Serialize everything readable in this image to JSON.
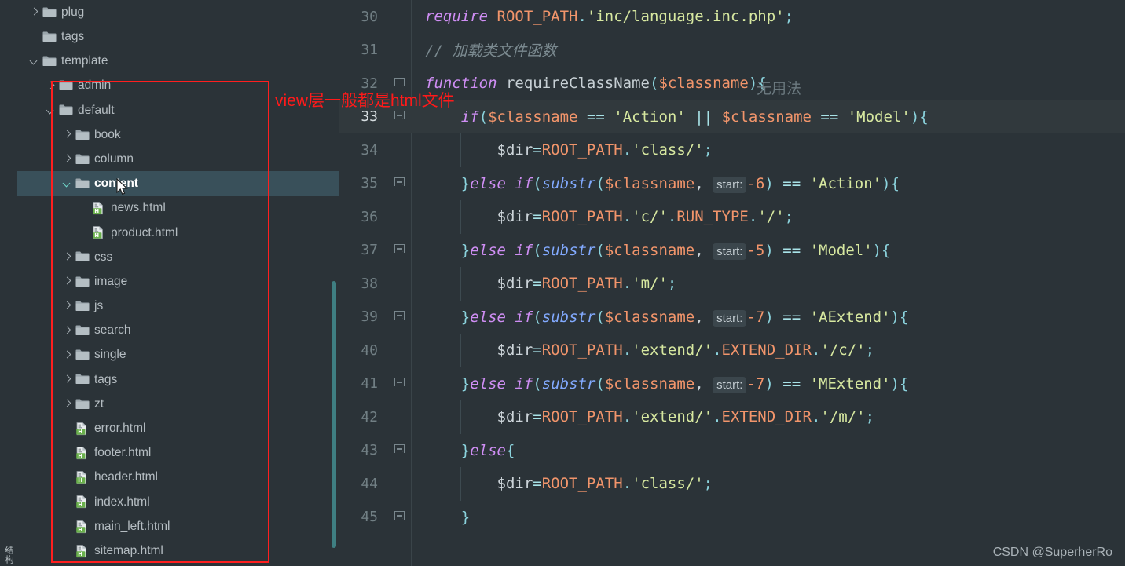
{
  "toolwindow": {
    "label": "结构"
  },
  "tree": {
    "scrollbar_color": "#3f7f82",
    "selected_color": "#39505a",
    "items": [
      {
        "label": "plug",
        "type": "folder",
        "indent": 1,
        "arrow": "right",
        "selected": false
      },
      {
        "label": "tags",
        "type": "folder",
        "indent": 1,
        "arrow": "none",
        "selected": false
      },
      {
        "label": "template",
        "type": "folder",
        "indent": 1,
        "arrow": "down",
        "selected": false
      },
      {
        "label": "admin",
        "type": "folder",
        "indent": 2,
        "arrow": "right",
        "selected": false
      },
      {
        "label": "default",
        "type": "folder",
        "indent": 2,
        "arrow": "down",
        "selected": false
      },
      {
        "label": "book",
        "type": "folder",
        "indent": 3,
        "arrow": "right",
        "selected": false
      },
      {
        "label": "column",
        "type": "folder",
        "indent": 3,
        "arrow": "right",
        "selected": false
      },
      {
        "label": "content",
        "type": "folder",
        "indent": 3,
        "arrow": "down",
        "selected": true
      },
      {
        "label": "news.html",
        "type": "html",
        "indent": 4,
        "arrow": "none",
        "selected": false
      },
      {
        "label": "product.html",
        "type": "html",
        "indent": 4,
        "arrow": "none",
        "selected": false
      },
      {
        "label": "css",
        "type": "folder",
        "indent": 3,
        "arrow": "right",
        "selected": false
      },
      {
        "label": "image",
        "type": "folder",
        "indent": 3,
        "arrow": "right",
        "selected": false
      },
      {
        "label": "js",
        "type": "folder",
        "indent": 3,
        "arrow": "right",
        "selected": false
      },
      {
        "label": "search",
        "type": "folder",
        "indent": 3,
        "arrow": "right",
        "selected": false
      },
      {
        "label": "single",
        "type": "folder",
        "indent": 3,
        "arrow": "right",
        "selected": false
      },
      {
        "label": "tags",
        "type": "folder",
        "indent": 3,
        "arrow": "right",
        "selected": false
      },
      {
        "label": "zt",
        "type": "folder",
        "indent": 3,
        "arrow": "right",
        "selected": false
      },
      {
        "label": "error.html",
        "type": "html",
        "indent": 3,
        "arrow": "none",
        "selected": false
      },
      {
        "label": "footer.html",
        "type": "html",
        "indent": 3,
        "arrow": "none",
        "selected": false
      },
      {
        "label": "header.html",
        "type": "html",
        "indent": 3,
        "arrow": "none",
        "selected": false
      },
      {
        "label": "index.html",
        "type": "html",
        "indent": 3,
        "arrow": "none",
        "selected": false
      },
      {
        "label": "main_left.html",
        "type": "html",
        "indent": 3,
        "arrow": "none",
        "selected": false
      },
      {
        "label": "sitemap.html",
        "type": "html",
        "indent": 3,
        "arrow": "none",
        "selected": false
      }
    ]
  },
  "annotation": {
    "text": "view层一般都是html文件",
    "color": "#ff1a1a"
  },
  "editor": {
    "ghost_hint": "无用法",
    "lines": [
      {
        "number": "30",
        "fold": false,
        "current": false,
        "indent_guides": 0,
        "tokens": [
          {
            "t": "require ",
            "c": "kw"
          },
          {
            "t": "ROOT_PATH",
            "c": "const"
          },
          {
            "t": ".",
            "c": "punc"
          },
          {
            "t": "'inc/language.inc.php'",
            "c": "str"
          },
          {
            "t": ";",
            "c": "punc"
          }
        ]
      },
      {
        "number": "31",
        "fold": false,
        "current": false,
        "indent_guides": 0,
        "tokens": [
          {
            "t": "// 加载类文件函数",
            "c": "comment"
          }
        ]
      },
      {
        "number": "32",
        "fold": true,
        "current": false,
        "indent_guides": 0,
        "tokens": [
          {
            "t": "function ",
            "c": "kw"
          },
          {
            "t": "requireClassName",
            "c": "fn"
          },
          {
            "t": "(",
            "c": "punc"
          },
          {
            "t": "$classname",
            "c": "var"
          },
          {
            "t": ")",
            "c": "punc"
          },
          {
            "t": "{",
            "c": "punc"
          }
        ]
      },
      {
        "number": "33",
        "fold": true,
        "current": true,
        "indent_guides": 0,
        "tokens": [
          {
            "t": "    ",
            "c": "plain"
          },
          {
            "t": "if",
            "c": "kw"
          },
          {
            "t": "(",
            "c": "punc"
          },
          {
            "t": "$classname",
            "c": "var"
          },
          {
            "t": " == ",
            "c": "op"
          },
          {
            "t": "'Action'",
            "c": "str"
          },
          {
            "t": " ",
            "c": "plain"
          },
          {
            "t": "||",
            "c": "op"
          },
          {
            "t": " ",
            "c": "plain"
          },
          {
            "t": "$classname",
            "c": "var"
          },
          {
            "t": " == ",
            "c": "op"
          },
          {
            "t": "'Model'",
            "c": "str"
          },
          {
            "t": ")",
            "c": "punc"
          },
          {
            "t": "{",
            "c": "punc"
          }
        ]
      },
      {
        "number": "34",
        "fold": false,
        "current": false,
        "indent_guides": 1,
        "tokens": [
          {
            "t": "        ",
            "c": "plain"
          },
          {
            "t": "$dir",
            "c": "plain"
          },
          {
            "t": "=",
            "c": "op"
          },
          {
            "t": "ROOT_PATH",
            "c": "const"
          },
          {
            "t": ".",
            "c": "punc"
          },
          {
            "t": "'class/'",
            "c": "str"
          },
          {
            "t": ";",
            "c": "punc"
          }
        ]
      },
      {
        "number": "35",
        "fold": true,
        "current": false,
        "indent_guides": 0,
        "tokens": [
          {
            "t": "    ",
            "c": "plain"
          },
          {
            "t": "}",
            "c": "punc"
          },
          {
            "t": "else if",
            "c": "kw"
          },
          {
            "t": "(",
            "c": "punc"
          },
          {
            "t": "substr",
            "c": "fnit"
          },
          {
            "t": "(",
            "c": "punc"
          },
          {
            "t": "$classname",
            "c": "var"
          },
          {
            "t": ", ",
            "c": "plain"
          },
          {
            "t": "start:",
            "c": "hint"
          },
          {
            "t": "-6",
            "c": "num"
          },
          {
            "t": ")",
            "c": "punc"
          },
          {
            "t": " == ",
            "c": "op"
          },
          {
            "t": "'Action'",
            "c": "str"
          },
          {
            "t": ")",
            "c": "punc"
          },
          {
            "t": "{",
            "c": "punc"
          }
        ]
      },
      {
        "number": "36",
        "fold": false,
        "current": false,
        "indent_guides": 1,
        "tokens": [
          {
            "t": "        ",
            "c": "plain"
          },
          {
            "t": "$dir",
            "c": "plain"
          },
          {
            "t": "=",
            "c": "op"
          },
          {
            "t": "ROOT_PATH",
            "c": "const"
          },
          {
            "t": ".",
            "c": "punc"
          },
          {
            "t": "'c/'",
            "c": "str"
          },
          {
            "t": ".",
            "c": "punc"
          },
          {
            "t": "RUN_TYPE",
            "c": "const"
          },
          {
            "t": ".",
            "c": "punc"
          },
          {
            "t": "'/'",
            "c": "str"
          },
          {
            "t": ";",
            "c": "punc"
          }
        ]
      },
      {
        "number": "37",
        "fold": true,
        "current": false,
        "indent_guides": 0,
        "tokens": [
          {
            "t": "    ",
            "c": "plain"
          },
          {
            "t": "}",
            "c": "punc"
          },
          {
            "t": "else if",
            "c": "kw"
          },
          {
            "t": "(",
            "c": "punc"
          },
          {
            "t": "substr",
            "c": "fnit"
          },
          {
            "t": "(",
            "c": "punc"
          },
          {
            "t": "$classname",
            "c": "var"
          },
          {
            "t": ", ",
            "c": "plain"
          },
          {
            "t": "start:",
            "c": "hint"
          },
          {
            "t": "-5",
            "c": "num"
          },
          {
            "t": ")",
            "c": "punc"
          },
          {
            "t": " == ",
            "c": "op"
          },
          {
            "t": "'Model'",
            "c": "str"
          },
          {
            "t": ")",
            "c": "punc"
          },
          {
            "t": "{",
            "c": "punc"
          }
        ]
      },
      {
        "number": "38",
        "fold": false,
        "current": false,
        "indent_guides": 1,
        "tokens": [
          {
            "t": "        ",
            "c": "plain"
          },
          {
            "t": "$dir",
            "c": "plain"
          },
          {
            "t": "=",
            "c": "op"
          },
          {
            "t": "ROOT_PATH",
            "c": "const"
          },
          {
            "t": ".",
            "c": "punc"
          },
          {
            "t": "'m/'",
            "c": "str"
          },
          {
            "t": ";",
            "c": "punc"
          }
        ]
      },
      {
        "number": "39",
        "fold": true,
        "current": false,
        "indent_guides": 0,
        "tokens": [
          {
            "t": "    ",
            "c": "plain"
          },
          {
            "t": "}",
            "c": "punc"
          },
          {
            "t": "else if",
            "c": "kw"
          },
          {
            "t": "(",
            "c": "punc"
          },
          {
            "t": "substr",
            "c": "fnit"
          },
          {
            "t": "(",
            "c": "punc"
          },
          {
            "t": "$classname",
            "c": "var"
          },
          {
            "t": ", ",
            "c": "plain"
          },
          {
            "t": "start:",
            "c": "hint"
          },
          {
            "t": "-7",
            "c": "num"
          },
          {
            "t": ")",
            "c": "punc"
          },
          {
            "t": " == ",
            "c": "op"
          },
          {
            "t": "'AExtend'",
            "c": "str"
          },
          {
            "t": ")",
            "c": "punc"
          },
          {
            "t": "{",
            "c": "punc"
          }
        ]
      },
      {
        "number": "40",
        "fold": false,
        "current": false,
        "indent_guides": 1,
        "tokens": [
          {
            "t": "        ",
            "c": "plain"
          },
          {
            "t": "$dir",
            "c": "plain"
          },
          {
            "t": "=",
            "c": "op"
          },
          {
            "t": "ROOT_PATH",
            "c": "const"
          },
          {
            "t": ".",
            "c": "punc"
          },
          {
            "t": "'extend/'",
            "c": "str"
          },
          {
            "t": ".",
            "c": "punc"
          },
          {
            "t": "EXTEND_DIR",
            "c": "const"
          },
          {
            "t": ".",
            "c": "punc"
          },
          {
            "t": "'/c/'",
            "c": "str"
          },
          {
            "t": ";",
            "c": "punc"
          }
        ]
      },
      {
        "number": "41",
        "fold": true,
        "current": false,
        "indent_guides": 0,
        "tokens": [
          {
            "t": "    ",
            "c": "plain"
          },
          {
            "t": "}",
            "c": "punc"
          },
          {
            "t": "else if",
            "c": "kw"
          },
          {
            "t": "(",
            "c": "punc"
          },
          {
            "t": "substr",
            "c": "fnit"
          },
          {
            "t": "(",
            "c": "punc"
          },
          {
            "t": "$classname",
            "c": "var"
          },
          {
            "t": ", ",
            "c": "plain"
          },
          {
            "t": "start:",
            "c": "hint"
          },
          {
            "t": "-7",
            "c": "num"
          },
          {
            "t": ")",
            "c": "punc"
          },
          {
            "t": " == ",
            "c": "op"
          },
          {
            "t": "'MExtend'",
            "c": "str"
          },
          {
            "t": ")",
            "c": "punc"
          },
          {
            "t": "{",
            "c": "punc"
          }
        ]
      },
      {
        "number": "42",
        "fold": false,
        "current": false,
        "indent_guides": 1,
        "tokens": [
          {
            "t": "        ",
            "c": "plain"
          },
          {
            "t": "$dir",
            "c": "plain"
          },
          {
            "t": "=",
            "c": "op"
          },
          {
            "t": "ROOT_PATH",
            "c": "const"
          },
          {
            "t": ".",
            "c": "punc"
          },
          {
            "t": "'extend/'",
            "c": "str"
          },
          {
            "t": ".",
            "c": "punc"
          },
          {
            "t": "EXTEND_DIR",
            "c": "const"
          },
          {
            "t": ".",
            "c": "punc"
          },
          {
            "t": "'/m/'",
            "c": "str"
          },
          {
            "t": ";",
            "c": "punc"
          }
        ]
      },
      {
        "number": "43",
        "fold": true,
        "current": false,
        "indent_guides": 0,
        "tokens": [
          {
            "t": "    ",
            "c": "plain"
          },
          {
            "t": "}",
            "c": "punc"
          },
          {
            "t": "else",
            "c": "kw"
          },
          {
            "t": "{",
            "c": "punc"
          }
        ]
      },
      {
        "number": "44",
        "fold": false,
        "current": false,
        "indent_guides": 1,
        "tokens": [
          {
            "t": "        ",
            "c": "plain"
          },
          {
            "t": "$dir",
            "c": "plain"
          },
          {
            "t": "=",
            "c": "op"
          },
          {
            "t": "ROOT_PATH",
            "c": "const"
          },
          {
            "t": ".",
            "c": "punc"
          },
          {
            "t": "'class/'",
            "c": "str"
          },
          {
            "t": ";",
            "c": "punc"
          }
        ]
      },
      {
        "number": "45",
        "fold": true,
        "current": false,
        "indent_guides": 0,
        "tokens": [
          {
            "t": "    ",
            "c": "plain"
          },
          {
            "t": "}",
            "c": "punc"
          }
        ]
      }
    ]
  },
  "watermark": {
    "text": "CSDN @SuperherRo"
  }
}
